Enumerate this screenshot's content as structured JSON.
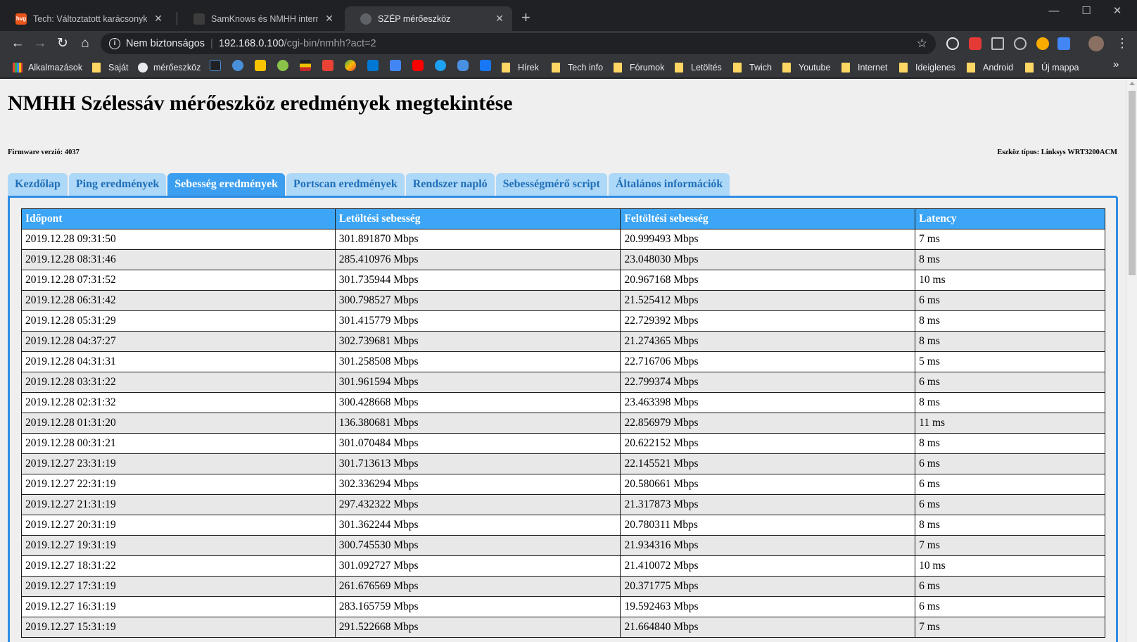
{
  "browser": {
    "tabs": [
      {
        "title": "Tech: Változtatott karácsonykor a",
        "favicon": "hvg",
        "active": false
      },
      {
        "title": "SamKnows és NMHH internet se",
        "favicon": "",
        "active": false
      },
      {
        "title": "SZÉP mérőeszköz",
        "favicon": "",
        "active": true
      }
    ],
    "tab_close_glyph": "✕",
    "new_tab_glyph": "+",
    "window_buttons": {
      "minimize": "—",
      "maximize": "☐",
      "close": "✕"
    },
    "address": {
      "security_label": "Nem biztonságos",
      "host": "192.168.0.100",
      "path": "/cgi-bin/nmhh?act=2"
    },
    "bookmarks": [
      {
        "label": "Alkalmazások",
        "type": "apps"
      },
      {
        "label": "Saját",
        "type": "folder"
      },
      {
        "label": "mérőeszköz",
        "type": "site"
      },
      {
        "label": "Hírek",
        "type": "folder"
      },
      {
        "label": "Tech info",
        "type": "folder"
      },
      {
        "label": "Fórumok",
        "type": "folder"
      },
      {
        "label": "Letöltés",
        "type": "folder"
      },
      {
        "label": "Twich",
        "type": "folder"
      },
      {
        "label": "Youtube",
        "type": "folder"
      },
      {
        "label": "Internet",
        "type": "folder"
      },
      {
        "label": "Ideiglenes",
        "type": "folder"
      },
      {
        "label": "Android",
        "type": "folder"
      },
      {
        "label": "Új mappa",
        "type": "folder"
      }
    ],
    "bookmarks_more": "»"
  },
  "page": {
    "title": "NMHH Szélessáv mérőeszköz eredmények megtekintése",
    "firmware": "Firmware verzió: 4037",
    "device": "Eszköz típus: Linksys WRT3200ACM",
    "tabs": [
      {
        "label": "Kezdőlap",
        "active": false
      },
      {
        "label": "Ping eredmények",
        "active": false
      },
      {
        "label": "Sebesség eredmények",
        "active": true
      },
      {
        "label": "Portscan eredmények",
        "active": false
      },
      {
        "label": "Rendszer napló",
        "active": false
      },
      {
        "label": "Sebességmérő script",
        "active": false
      },
      {
        "label": "Általános információk",
        "active": false
      }
    ],
    "table": {
      "headers": [
        "Időpont",
        "Letöltési sebesség",
        "Feltöltési sebesség",
        "Latency"
      ],
      "rows": [
        [
          "2019.12.28 09:31:50",
          "301.891870 Mbps",
          "20.999493 Mbps",
          "7 ms"
        ],
        [
          "2019.12.28 08:31:46",
          "285.410976 Mbps",
          "23.048030 Mbps",
          "8 ms"
        ],
        [
          "2019.12.28 07:31:52",
          "301.735944 Mbps",
          "20.967168 Mbps",
          "10 ms"
        ],
        [
          "2019.12.28 06:31:42",
          "300.798527 Mbps",
          "21.525412 Mbps",
          "6 ms"
        ],
        [
          "2019.12.28 05:31:29",
          "301.415779 Mbps",
          "22.729392 Mbps",
          "8 ms"
        ],
        [
          "2019.12.28 04:37:27",
          "302.739681 Mbps",
          "21.274365 Mbps",
          "8 ms"
        ],
        [
          "2019.12.28 04:31:31",
          "301.258508 Mbps",
          "22.716706 Mbps",
          "5 ms"
        ],
        [
          "2019.12.28 03:31:22",
          "301.961594 Mbps",
          "22.799374 Mbps",
          "6 ms"
        ],
        [
          "2019.12.28 02:31:32",
          "300.428668 Mbps",
          "23.463398 Mbps",
          "8 ms"
        ],
        [
          "2019.12.28 01:31:20",
          "136.380681 Mbps",
          "22.856979 Mbps",
          "11 ms"
        ],
        [
          "2019.12.28 00:31:21",
          "301.070484 Mbps",
          "20.622152 Mbps",
          "8 ms"
        ],
        [
          "2019.12.27 23:31:19",
          "301.713613 Mbps",
          "22.145521 Mbps",
          "6 ms"
        ],
        [
          "2019.12.27 22:31:19",
          "302.336294 Mbps",
          "20.580661 Mbps",
          "6 ms"
        ],
        [
          "2019.12.27 21:31:19",
          "297.432322 Mbps",
          "21.317873 Mbps",
          "6 ms"
        ],
        [
          "2019.12.27 20:31:19",
          "301.362244 Mbps",
          "20.780311 Mbps",
          "8 ms"
        ],
        [
          "2019.12.27 19:31:19",
          "300.745530 Mbps",
          "21.934316 Mbps",
          "7 ms"
        ],
        [
          "2019.12.27 18:31:22",
          "301.092727 Mbps",
          "21.410072 Mbps",
          "10 ms"
        ],
        [
          "2019.12.27 17:31:19",
          "261.676569 Mbps",
          "20.371775 Mbps",
          "6 ms"
        ],
        [
          "2019.12.27 16:31:19",
          "283.165759 Mbps",
          "19.592463 Mbps",
          "6 ms"
        ],
        [
          "2019.12.27 15:31:19",
          "291.522668 Mbps",
          "21.664840 Mbps",
          "7 ms"
        ]
      ]
    }
  },
  "colors": {
    "tab_inactive_bg": "#aed8f8",
    "tab_active_bg": "#3b9ef0",
    "header_bg": "#3da5f5",
    "panel_border": "#2f8de4"
  }
}
